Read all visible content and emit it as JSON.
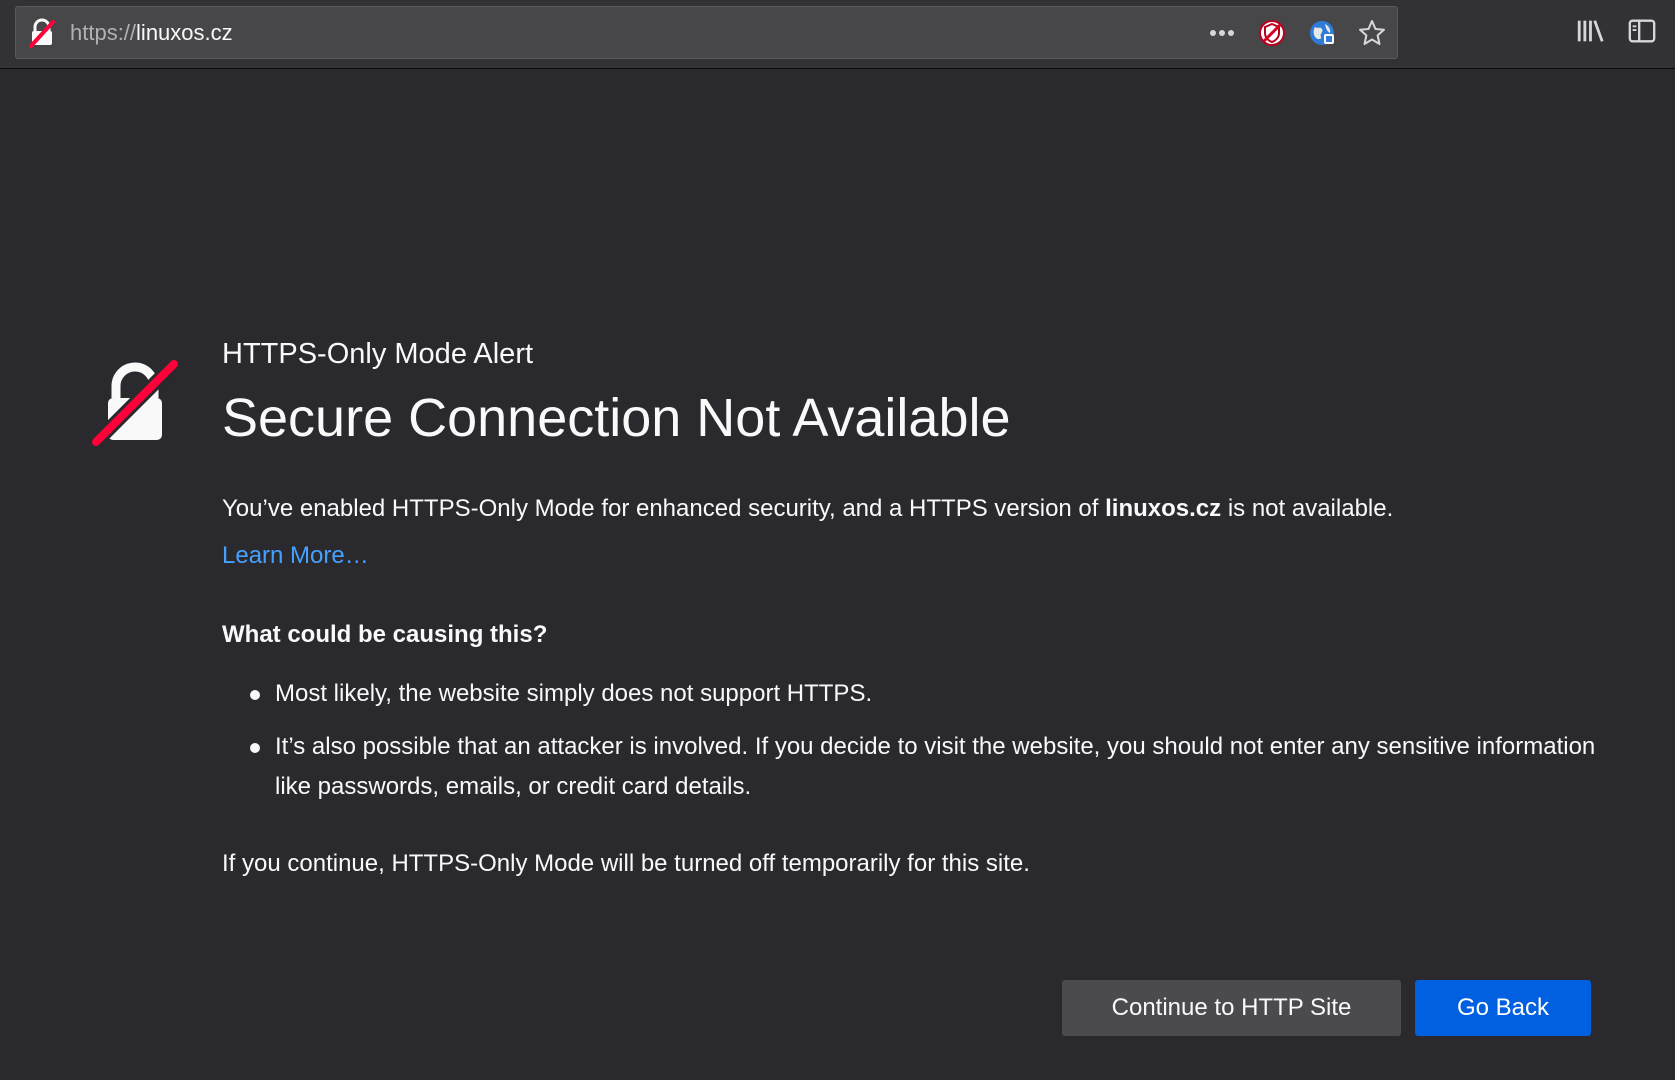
{
  "urlbar": {
    "scheme": "https://",
    "host": "linuxos.cz"
  },
  "icons": {
    "url_lock": "broken-lock-icon",
    "page_actions": "more-dots-icon",
    "ublock": "shield-extension-icon",
    "translate": "globe-extension-icon",
    "bookmark": "star-icon",
    "library": "library-icon",
    "sidebar": "sidebar-icon"
  },
  "page": {
    "alert_label": "HTTPS-Only Mode Alert",
    "title": "Secure Connection Not Available",
    "intro_before": "You’ve enabled HTTPS-Only Mode for enhanced security, and a HTTPS version of ",
    "intro_site": "linuxos.cz",
    "intro_after": " is not available.",
    "learn_more": "Learn More…",
    "cause_title": "What could be causing this?",
    "causes": [
      "Most likely, the website simply does not support HTTPS.",
      "It’s also possible that an attacker is involved. If you decide to visit the website, you should not enter any sensitive information like passwords, emails, or credit card details."
    ],
    "continue_note": "If you continue, HTTPS-Only Mode will be turned off temporarily for this site."
  },
  "buttons": {
    "continue": "Continue to HTTP Site",
    "back": "Go Back"
  },
  "colors": {
    "background": "#2a2a2e",
    "link": "#45a1ff",
    "primary_button": "#0060df",
    "secondary_button": "#4a4a4f",
    "alert_red": "#ff0039"
  }
}
